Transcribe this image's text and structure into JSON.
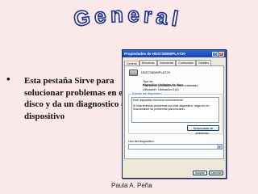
{
  "slide": {
    "title": "General",
    "bullet_symbol": "•",
    "bullet_text": "Esta pestaña Sirve para solucionar problemas en el disco y da un diagnostico del dispositivo",
    "footer": "Paula A. Peña"
  },
  "dialog": {
    "title": "Propiedades de HDS728080PLAT20",
    "help_label": "?",
    "close_label": "×",
    "tabs": [
      {
        "label": "General",
        "active": true
      },
      {
        "label": "Directivas",
        "active": false
      },
      {
        "label": "Volúmenes",
        "active": false
      },
      {
        "label": "Controlador",
        "active": false
      },
      {
        "label": "Detalles",
        "active": false
      }
    ],
    "device_name": "HDS728080PLAT20",
    "properties": [
      {
        "key": "Tipo de dispositivo:",
        "value": "Unidades de disco"
      },
      {
        "key": "Fabricante:",
        "value": "(Unidades de disco estándar)"
      },
      {
        "key": "Ubicación:",
        "value": "Ubicación 0 (0)"
      }
    ],
    "status_group_label": "Estado del dispositivo",
    "status_text_1": "Este dispositivo funciona correctamente.",
    "status_text_2": "Si está teniendo problemas con este dispositivo, haga clic en Solucionador de problemas para iniciarlo.",
    "solver_button": "Solucionador de problemas...",
    "usage_label": "Uso del dispositivo:",
    "usage_value": "",
    "buttons": {
      "ok": "Aceptar",
      "cancel": "Cancelar"
    }
  },
  "colors": {
    "background": "#fbe9e9",
    "title_outline": "#1b2f8f",
    "titlebar": "#2a63d8"
  }
}
